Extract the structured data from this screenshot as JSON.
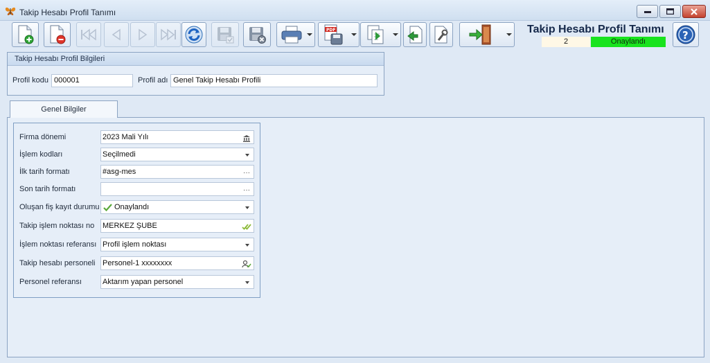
{
  "window": {
    "title": "Takip Hesabı Profil Tanımı"
  },
  "header": {
    "title": "Takip Hesabı Profil Tanımı",
    "count": "2",
    "status": "Onaylandı",
    "status_color": "#19e31e"
  },
  "toolbar": {
    "icons": [
      "new-document-icon",
      "delete-document-icon",
      "first-record-icon",
      "previous-record-icon",
      "next-record-icon",
      "last-record-icon",
      "refresh-icon",
      "save-icon",
      "save-close-icon",
      "print-icon",
      "pdf-export-icon",
      "export-icon",
      "import-icon",
      "settings-icon",
      "exit-icon",
      "help-icon"
    ]
  },
  "profile_group": {
    "title": "Takip Hesabı Profil Bilgileri",
    "code_label": "Profil kodu",
    "code_value": "000001",
    "name_label": "Profil adı",
    "name_value": "Genel Takip Hesabı Profili"
  },
  "tabs": [
    {
      "label": "Genel Bilgiler",
      "active": true
    }
  ],
  "form": {
    "fields": [
      {
        "label": "Firma dönemi",
        "value": "2023 Mali Yılı",
        "icon": "bank-icon"
      },
      {
        "label": "İşlem kodları",
        "value": "Seçilmedi",
        "icon": "dropdown-arrow"
      },
      {
        "label": "İlk tarih formatı",
        "value": "#asg-mes",
        "icon": "ellipsis-icon"
      },
      {
        "label": "Son tarih formatı",
        "value": "",
        "icon": "ellipsis-icon"
      },
      {
        "label": "Oluşan fiş kayıt durumu",
        "value": "Onaylandı",
        "icon": "dropdown-arrow"
      },
      {
        "label": "Takip işlem noktası no",
        "value": "MERKEZ ŞUBE",
        "icon": "double-check-icon"
      },
      {
        "label": "İşlem noktası referansı",
        "value": "Profil işlem noktası",
        "icon": "dropdown-arrow"
      },
      {
        "label": "Takip hesabı personeli",
        "value": "Personel-1 xxxxxxxx",
        "icon": "person-lookup-icon"
      },
      {
        "label": "Personel referansı",
        "value": "Aktarım yapan personel",
        "icon": "dropdown-arrow"
      }
    ]
  }
}
